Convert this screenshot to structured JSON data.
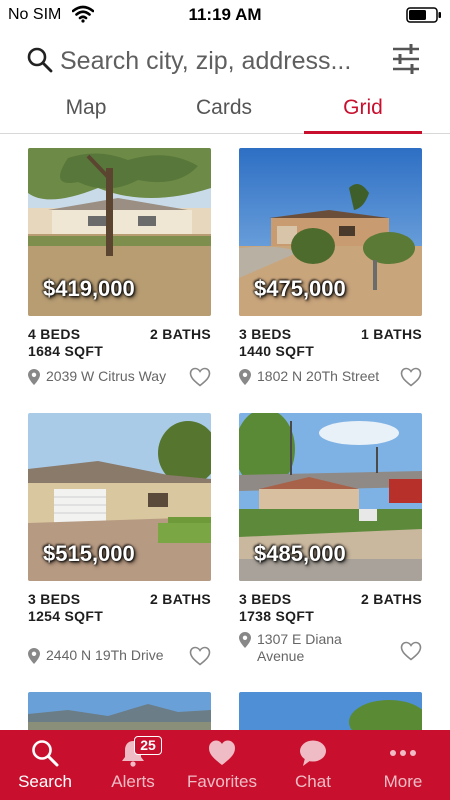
{
  "status_bar": {
    "carrier": "No SIM",
    "time": "11:19 AM"
  },
  "search": {
    "placeholder": "Search city, zip, address..."
  },
  "tabs": [
    {
      "label": "Map",
      "active": false
    },
    {
      "label": "Cards",
      "active": false
    },
    {
      "label": "Grid",
      "active": true
    }
  ],
  "listings": [
    {
      "price": "$419,000",
      "beds": "4 BEDS",
      "baths": "2 BATHS",
      "sqft": "1684 SQFT",
      "address": "2039 W Citrus Way"
    },
    {
      "price": "$475,000",
      "beds": "3 BEDS",
      "baths": "1 BATHS",
      "sqft": "1440 SQFT",
      "address": "1802 N 20Th Street"
    },
    {
      "price": "$515,000",
      "beds": "3 BEDS",
      "baths": "2 BATHS",
      "sqft": "1254 SQFT",
      "address": "2440 N 19Th Drive"
    },
    {
      "price": "$485,000",
      "beds": "3 BEDS",
      "baths": "2 BATHS",
      "sqft": "1738 SQFT",
      "address": "1307 E Diana Avenue"
    }
  ],
  "bottom_nav": [
    {
      "label": "Search",
      "icon": "search-icon",
      "active": true
    },
    {
      "label": "Alerts",
      "icon": "bell-icon",
      "badge": "25"
    },
    {
      "label": "Favorites",
      "icon": "heart-icon"
    },
    {
      "label": "Chat",
      "icon": "chat-bubble-icon"
    },
    {
      "label": "More",
      "icon": "more-dots-icon"
    }
  ],
  "colors": {
    "accent": "#c8102e",
    "nav_background": "#c8102e",
    "text_secondary": "#666666"
  }
}
